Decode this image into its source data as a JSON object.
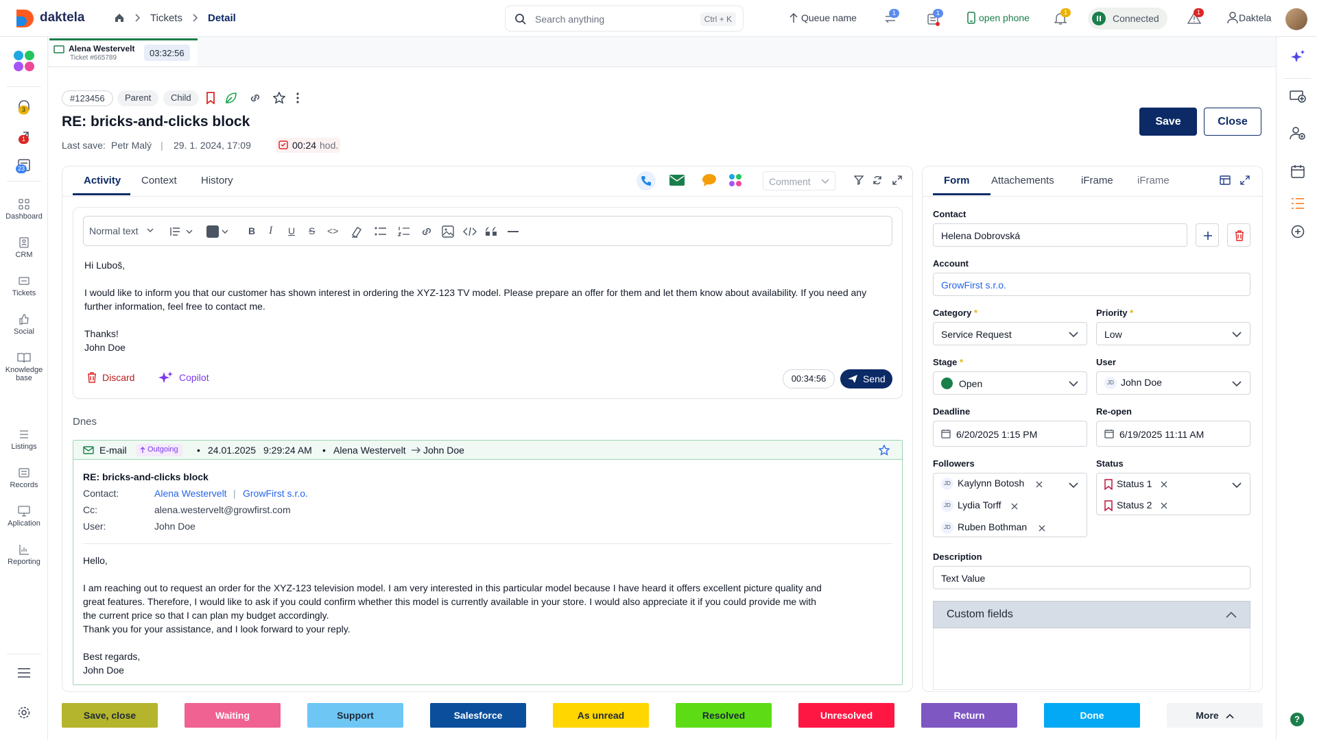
{
  "app": {
    "brand": "daktela"
  },
  "breadcrumb": {
    "tickets": "Tickets",
    "detail": "Detail"
  },
  "search": {
    "placeholder": "Search anything",
    "shortcut": "Ctrl + K"
  },
  "topbar": {
    "queue_name": "Queue name",
    "transfer_badge": "1",
    "tickets_badge": "1",
    "open_phone": "open phone",
    "bell_badge": "1",
    "connected": "Connected",
    "alert_badge": "1",
    "user": "Daktela"
  },
  "sidebar": {
    "items": [
      {
        "label": "",
        "badge": "3"
      },
      {
        "label": "",
        "badge": "1"
      },
      {
        "label": "",
        "badge": "23"
      },
      {
        "label": "Dashboard"
      },
      {
        "label": "CRM"
      },
      {
        "label": "Tickets"
      },
      {
        "label": "Social"
      },
      {
        "label": "Knowledge base"
      },
      {
        "label": "Listings"
      },
      {
        "label": "Records"
      },
      {
        "label": "Aplication"
      },
      {
        "label": "Reporting"
      }
    ]
  },
  "session": {
    "name": "Alena Westervelt",
    "ticket": "Ticket #665789",
    "timer": "03:32:56"
  },
  "ticket": {
    "id_chip": "#123456",
    "parent_chip": "Parent",
    "child_chip": "Child",
    "title": "RE: bricks-and-clicks block",
    "last_save_label": "Last save:",
    "last_save_user": "Petr Malý",
    "last_save_date": "29. 1. 2024, 17:09",
    "sla": "00:24",
    "sla_unit": "hod."
  },
  "actions": {
    "save": "Save",
    "close": "Close"
  },
  "activity": {
    "tabs": [
      "Activity",
      "Context",
      "History"
    ],
    "comment_select": "Comment",
    "editor": {
      "text_style": "Normal text",
      "greeting": "Hi Luboš,",
      "line1": "I would like to inform you that our customer has shown interest in ordering the XYZ-123 TV model. Please prepare an offer for them and let them know about availability. If you need any",
      "line2": "further information, feel free to contact me.",
      "thanks": "Thanks!",
      "signature": "John Doe",
      "discard": "Discard",
      "copilot": "Copilot",
      "timer": "00:34:56",
      "send": "Send"
    },
    "day_label": "Dnes",
    "email": {
      "type": "E-mail",
      "direction": "Outgoing",
      "date": "24.01.2025",
      "time": "9:29:24 AM",
      "from": "Alena Westervelt",
      "to": "John Doe",
      "subject": "RE: bricks-and-clicks block",
      "contact_label": "Contact:",
      "contact_name": "Alena Westervelt",
      "contact_company": "GrowFirst s.r.o.",
      "cc_label": "Cc:",
      "cc_value": "alena.westervelt@growfirst.com",
      "user_label": "User:",
      "user_value": "John Doe",
      "hello": "Hello,",
      "p1": "I am reaching out to request an order for the XYZ-123 television model. I am very interested in this particular model because I have heard it offers excellent picture quality and",
      "p2": "great features. Therefore, I would like to ask if you could confirm whether this model is currently available in your store. I would also appreciate it if you could provide me with",
      "p3": "the current price so that I can plan my budget accordingly.",
      "p4": "Thank you for your assistance, and I look forward to your reply.",
      "regards": "Best regards,",
      "sign": "John Doe"
    }
  },
  "form": {
    "tabs": [
      "Form",
      "Attachements",
      "iFrame",
      "iFrame"
    ],
    "contact_label": "Contact",
    "contact_value": "Helena Dobrovská",
    "account_label": "Account",
    "account_value": "GrowFirst s.r.o.",
    "category_label": "Category",
    "category_value": "Service Request",
    "priority_label": "Priority",
    "priority_value": "Low",
    "stage_label": "Stage",
    "stage_value": "Open",
    "user_label": "User",
    "user_initials": "JD",
    "user_value": "John Doe",
    "deadline_label": "Deadline",
    "deadline_value": "6/20/2025 1:15 PM",
    "reopen_label": "Re-open",
    "reopen_value": "6/19/2025 11:11 AM",
    "followers_label": "Followers",
    "followers": [
      {
        "initials": "JD",
        "name": "Kaylynn Botosh"
      },
      {
        "initials": "JD",
        "name": "Lydia Torff"
      },
      {
        "initials": "JD",
        "name": "Ruben Bothman"
      }
    ],
    "status_label": "Status",
    "statuses": [
      "Status 1",
      "Status 2"
    ],
    "description_label": "Description",
    "description_value": "Text Value",
    "custom_fields": "Custom fields"
  },
  "bottom_buttons": [
    {
      "label": "Save, close",
      "color": "#b5b52d",
      "text": "#1f2937"
    },
    {
      "label": "Waiting",
      "color": "#f06292",
      "text": "#ffffff"
    },
    {
      "label": "Support",
      "color": "#6ec6f5",
      "text": "#1f2937"
    },
    {
      "label": "Salesforce",
      "color": "#0b4f9c",
      "text": "#ffffff"
    },
    {
      "label": "As unread",
      "color": "#ffd600",
      "text": "#1f2937"
    },
    {
      "label": "Resolved",
      "color": "#5ddc16",
      "text": "#1f2937"
    },
    {
      "label": "Unresolved",
      "color": "#ff1744",
      "text": "#ffffff"
    },
    {
      "label": "Return",
      "color": "#7e57c2",
      "text": "#ffffff"
    },
    {
      "label": "Done",
      "color": "#03a9f4",
      "text": "#ffffff"
    },
    {
      "label": "More",
      "color": "#f3f4f6",
      "text": "#1f2937"
    }
  ],
  "colors": {
    "primary": "#0b2a66",
    "accent": "#1a7f4b",
    "danger": "#dc2626"
  }
}
